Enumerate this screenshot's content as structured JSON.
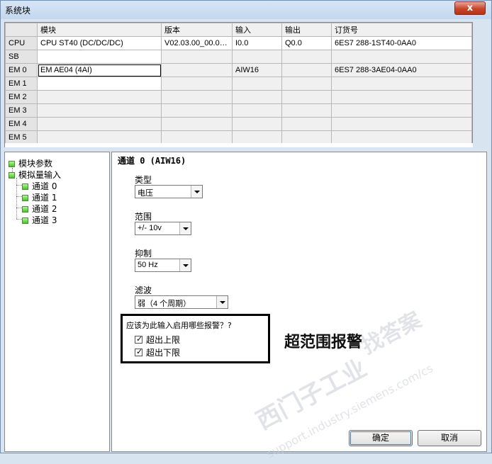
{
  "window": {
    "title": "系统块",
    "close_symbol": "x"
  },
  "table": {
    "columns": [
      "",
      "模块",
      "版本",
      "输入",
      "输出",
      "订货号"
    ],
    "rows": [
      {
        "slot": "CPU",
        "module": "CPU ST40 (DC/DC/DC)",
        "version": "V02.03.00_00.00...",
        "input": "I0.0",
        "output": "Q0.0",
        "order": "6ES7 288-1ST40-0AA0"
      },
      {
        "slot": "SB",
        "module": "",
        "version": "",
        "input": "",
        "output": "",
        "order": ""
      },
      {
        "slot": "EM 0",
        "module": "EM AE04 (4AI)",
        "version": "",
        "input": "AIW16",
        "output": "",
        "order": "6ES7 288-3AE04-0AA0"
      },
      {
        "slot": "EM 1",
        "module": "",
        "version": "",
        "input": "",
        "output": "",
        "order": ""
      },
      {
        "slot": "EM 2",
        "module": "",
        "version": "",
        "input": "",
        "output": "",
        "order": ""
      },
      {
        "slot": "EM 3",
        "module": "",
        "version": "",
        "input": "",
        "output": "",
        "order": ""
      },
      {
        "slot": "EM 4",
        "module": "",
        "version": "",
        "input": "",
        "output": "",
        "order": ""
      },
      {
        "slot": "EM 5",
        "module": "",
        "version": "",
        "input": "",
        "output": "",
        "order": ""
      }
    ]
  },
  "tree": {
    "module_params": "模块参数",
    "analog_input": "模拟量输入",
    "channels": [
      "通道 0",
      "通道 1",
      "通道 2",
      "通道 3"
    ]
  },
  "detail": {
    "channel_title": "通道 0 (AIW16)",
    "type_label": "类型",
    "type_value": "电压",
    "range_label": "范围",
    "range_value": "+/- 10v",
    "rejection_label": "抑制",
    "rejection_value": "50 Hz",
    "filter_label": "滤波",
    "filter_value": "弱（4 个周期）",
    "alarm_question": "应该为此输入启用哪些报警？?",
    "alarm_upper": "超出上限",
    "alarm_lower": "超出下限",
    "alarm_upper_checked": true,
    "alarm_lower_checked": true,
    "annotation": "超范围报警",
    "watermark_lines": [
      "西门子工业",
      "support.industry.siemens.com/cs",
      "找答案"
    ]
  },
  "buttons": {
    "ok": "确定",
    "cancel": "取消"
  },
  "colors": {
    "window_bg": "#d9e4f1",
    "close_red": "#c8452c",
    "tree_green": "#46c625"
  }
}
